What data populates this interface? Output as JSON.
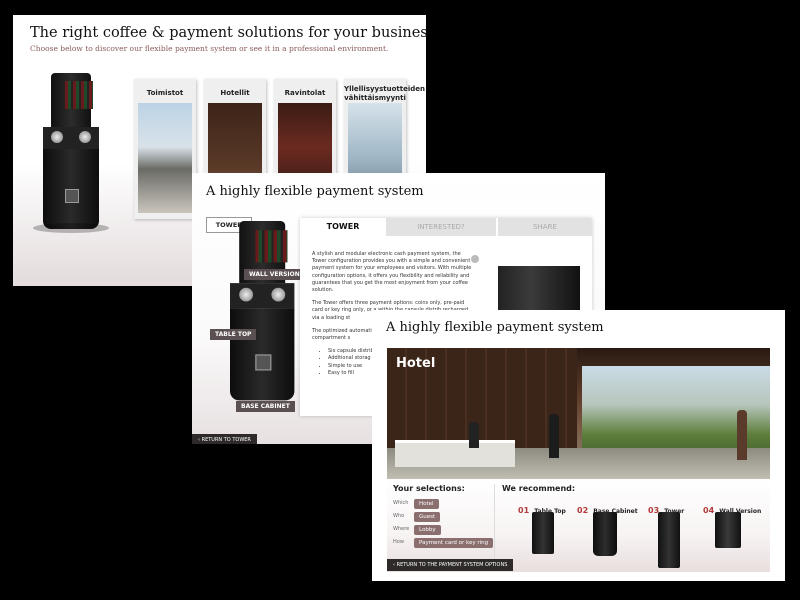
{
  "screen1": {
    "title": "The right coffee & payment solutions for your business",
    "subtitle": "Choose below to discover our flexible payment system or see it in a professional environment.",
    "cards": [
      {
        "label": "Toimistot"
      },
      {
        "label": "Hotellit"
      },
      {
        "label": "Ravintolat"
      },
      {
        "label": "Yllellisyystuotteiden vähittäismyynti"
      }
    ]
  },
  "screen2": {
    "title": "A highly flexible payment system",
    "tower_tag": "TOWER",
    "callouts": {
      "wall": "WALL VERSION",
      "table": "TABLE TOP",
      "base": "BASE CABINET"
    },
    "tabs": [
      "TOWER",
      "INTERESTED?",
      "SHARE"
    ],
    "paragraphs": [
      "A stylish and modular electronic cash payment system, the Tower configuration provides you with a simple and convenient payment system for your employees and visitors. With multiple configuration options, it offers you flexibility and reliability and guarantees that you get the most enjoyment from your coffee solution.",
      "The Tower offers three payment options: coins only, pre-paid card or key ring only, or a within the capsule distrib recharged via a loading st",
      "The optimized automatic coffee varieties and stock an optimal compartment s"
    ],
    "bullets": [
      "Six capsule distrib",
      "Additional storag",
      "Simple to use",
      "Easy to fill"
    ],
    "return_label": "RETURN TO TOWER"
  },
  "screen3": {
    "title": "A highly flexible payment system",
    "hero_label": "Hotel",
    "selections_title": "Your selections:",
    "selections": [
      {
        "label": "Which",
        "value": "Hotel"
      },
      {
        "label": "Who",
        "value": "Guest"
      },
      {
        "label": "Where",
        "value": "Lobby"
      },
      {
        "label": "How",
        "value": "Payment card or key ring"
      }
    ],
    "recommend_title": "We recommend:",
    "recommendations": [
      {
        "num": "01",
        "name": "Table Top"
      },
      {
        "num": "02",
        "name": "Base Cabinet"
      },
      {
        "num": "03",
        "name": "Tower"
      },
      {
        "num": "04",
        "name": "Wall Version"
      }
    ],
    "return_label": "RETURN TO THE PAYMENT SYSTEM OPTIONS"
  }
}
